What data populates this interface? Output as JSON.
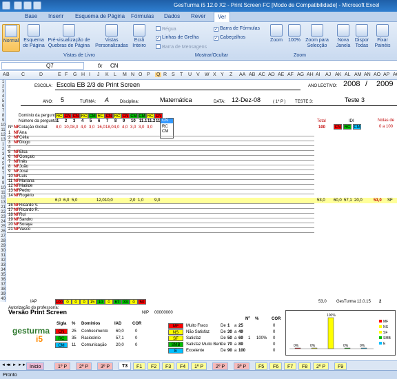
{
  "window": {
    "title": "GesTurma i5 12.0 X2 - Print Screen FC  [Modo de Compatibilidade] - Microsoft Excel"
  },
  "ribbon": {
    "tabs": [
      "Base",
      "Inserir",
      "Esquema de Página",
      "Fórmulas",
      "Dados",
      "Rever",
      "Ver"
    ],
    "active_tab": "Ver",
    "views": [
      "Normal",
      "Esquema de Página",
      "Pré-visualização de Quebras de Página",
      "Vistas Personalizadas",
      "Ecrã Inteiro"
    ],
    "views_group": "Vistas de Livro",
    "show_checks": [
      "Régua",
      "Linhas de Grelha",
      "Barra de Mensagens",
      "Barra de Fórmulas",
      "Cabeçalhos"
    ],
    "show_group": "Mostrar/Ocultar",
    "zoom_btns": [
      "Zoom",
      "100%",
      "Zoom para Selecção"
    ],
    "zoom_group": "Zoom",
    "window_btns": [
      "Nova Janela",
      "Dispor Todas",
      "Fixar Painéis"
    ]
  },
  "formula": {
    "cell": "Q7",
    "fx": "fx",
    "value": "CN"
  },
  "columns": [
    "A",
    "B",
    "C",
    "D",
    "E",
    "F",
    "G",
    "H",
    "I",
    "J",
    "K",
    "L",
    "M",
    "N",
    "O",
    "P",
    "Q",
    "R",
    "S",
    "T",
    "U",
    "V",
    "W",
    "X",
    "Y",
    "Z",
    "AA",
    "AB",
    "AC",
    "AD",
    "AE",
    "AF",
    "AG",
    "AH",
    "AI",
    "AJ",
    "AK",
    "AL",
    "AM",
    "AN",
    "AO",
    "AP",
    "AQ"
  ],
  "rows": [
    "1",
    "2",
    "3",
    "4",
    "5",
    "6",
    "7",
    "8",
    "9",
    "10",
    "11",
    "12",
    "13",
    "1",
    "2",
    "3",
    "4",
    "5",
    "6",
    "7",
    "8",
    "9",
    "10",
    "11",
    "12",
    "13",
    "21",
    "22",
    "23",
    "24",
    "25",
    "26",
    "27",
    "28",
    "29",
    "30",
    "31",
    "32",
    "33",
    "34",
    "35",
    "36",
    "37",
    "38",
    "39",
    "40"
  ],
  "header": {
    "escola_label": "ESCOLA:",
    "escola": "Escola EB 2/3 de Print Screen",
    "ano_lectivo_label": "ANO LECTIVO:",
    "ano1": "2008",
    "slash": "/",
    "ano2": "2009",
    "ano_label": "ANO:",
    "ano": "5",
    "turma_label": "TURMA:",
    "turma": "A",
    "disciplina_label": "Disciplina:",
    "disciplina": "Matemática",
    "data_label": "DATA:",
    "data": "12-Dez-08",
    "periodo": "( 1º P )",
    "teste_label": "TESTE 3:",
    "teste": "Teste 3"
  },
  "grid": {
    "dominio_label": "Domínio da pergunta:",
    "numero_label": "Número da pergunta:",
    "cotacao_label": "Cotação Global:",
    "n_label": "Nº",
    "nf_label": "NF",
    "dominios": [
      "RC",
      "CN",
      "CN",
      "RC",
      "CM",
      "RC",
      "CN",
      "RC",
      "CN",
      "CM",
      "CM",
      "RC",
      "CN"
    ],
    "numeros": [
      "1",
      "2",
      "3",
      "4",
      "5",
      "6",
      "7",
      "8",
      "9",
      "10",
      "11.1",
      "11.2",
      "11.3"
    ],
    "cotacoes": [
      "8,0",
      "10,0",
      "8,0",
      "4,0",
      "3,0",
      "16,0",
      "18,0",
      "4,0",
      "4,0",
      "3,0",
      "3,0",
      "3,0"
    ],
    "dropdown": [
      "CN",
      "RC",
      "CM"
    ],
    "total_label": "Total",
    "total": "100",
    "idi_label": "IDI",
    "idi_codes": [
      "CN",
      "RC",
      "CM"
    ],
    "notas_label": "Notas de",
    "notas_range": "0 a 100",
    "students": [
      "Ana",
      "Célia",
      "Diogo",
      "",
      "Elsa",
      "Gonçalo",
      "Inês",
      "João",
      "José",
      "Luís",
      "Mariana",
      "Matilde",
      "Pedro",
      "Rogério",
      "Rosana",
      "Ricardo V.",
      "Ricardo R.",
      "Rui",
      "Sandro",
      "Soraya",
      "Vasco"
    ],
    "nf_tag": "NF",
    "pedro_scores": [
      "6,0",
      "6,0",
      "5,0",
      "12,0",
      "10,0",
      "2,0",
      "1,0",
      "9,0"
    ],
    "pedro_total": "53,0",
    "pedro_idi": [
      "60,0",
      "57,1",
      "20,0"
    ],
    "pedro_nota": "53,0",
    "pedro_grade": "SF",
    "iap_label": "IAP",
    "iap_values": [
      "100",
      "0",
      "0",
      "0",
      "15",
      "10",
      "0",
      "67",
      "33",
      "0",
      "50"
    ],
    "iap_total": "53,0",
    "gesturma_tag": "GesTurma 12.0.15",
    "page_num": "2"
  },
  "footer": {
    "autorizacao": "Autorização do professor/a:",
    "versao": "Versão Print Screen",
    "nip_label": "NIP",
    "nip": "00000000",
    "logo_text": "gesturma",
    "logo_version": "i5",
    "legend_headers": [
      "Sigla",
      "%",
      "Domínios",
      "IAD",
      "COR"
    ],
    "legend_rows": [
      {
        "sigla": "CN",
        "pct": "25",
        "dominio": "Conhecimento",
        "iad": "60,0",
        "cor": "0",
        "color": "#ff0000"
      },
      {
        "sigla": "RC",
        "pct": "35",
        "dominio": "Raciocínio",
        "iad": "57,1",
        "cor": "0",
        "color": "#00c000"
      },
      {
        "sigla": "CM",
        "pct": "11",
        "dominio": "Comunicação",
        "iad": "20,0",
        "cor": "0",
        "color": "#00c0ff"
      }
    ],
    "grade_rows": [
      {
        "code": "MF",
        "label": "Muito Fraco",
        "de": "De",
        "a": "1",
        "to": "a",
        "b": "25",
        "cnt": "",
        "pct": "",
        "cor": "0",
        "color": "#ff0000"
      },
      {
        "code": "NS",
        "label": "Não Satisfaz",
        "de": "De",
        "a": "30",
        "to": "a",
        "b": "49",
        "cnt": "",
        "pct": "",
        "cor": "0",
        "color": "#ffff00"
      },
      {
        "code": "SF",
        "label": "Satisfaz",
        "de": "De",
        "a": "50",
        "to": "a",
        "b": "69",
        "cnt": "1",
        "pct": "100%",
        "cor": "0",
        "color": "#ffff00"
      },
      {
        "code": "SMB",
        "label": "Satisfaz Muito Bem",
        "de": "De",
        "a": "70",
        "to": "a",
        "b": "89",
        "cnt": "",
        "pct": "",
        "cor": "0",
        "color": "#00c000"
      },
      {
        "code": "E",
        "label": "Excelente",
        "de": "De",
        "a": "90",
        "to": "a",
        "b": "100",
        "cnt": "",
        "pct": "",
        "cor": "0",
        "color": "#00c0ff"
      }
    ],
    "grade_hdr": [
      "Nº",
      "%",
      "COR"
    ],
    "chart_pct_top": "100%",
    "chart_pcts": [
      "0%",
      "0%",
      "100%",
      "0%",
      "0%"
    ],
    "chart_legend": [
      "MF",
      "NS",
      "SF",
      "SMB",
      "E"
    ]
  },
  "chart_data": {
    "type": "bar",
    "categories": [
      "MF",
      "NS",
      "SF",
      "SMB",
      "E"
    ],
    "values": [
      0,
      0,
      100,
      0,
      0
    ],
    "colors": [
      "#ff0000",
      "#ffff00",
      "#ffff00",
      "#00c000",
      "#00c0ff"
    ]
  },
  "sheets": [
    "Inicio",
    "1º P",
    "2º P",
    "3º P",
    "T3",
    "F1",
    "F2",
    "F3",
    "F4",
    "1º P",
    "2º P",
    "3º P",
    "F5",
    "F6",
    "F7",
    "F8",
    "2º P",
    "F9"
  ],
  "active_sheet": "T3",
  "status": "Pronto"
}
